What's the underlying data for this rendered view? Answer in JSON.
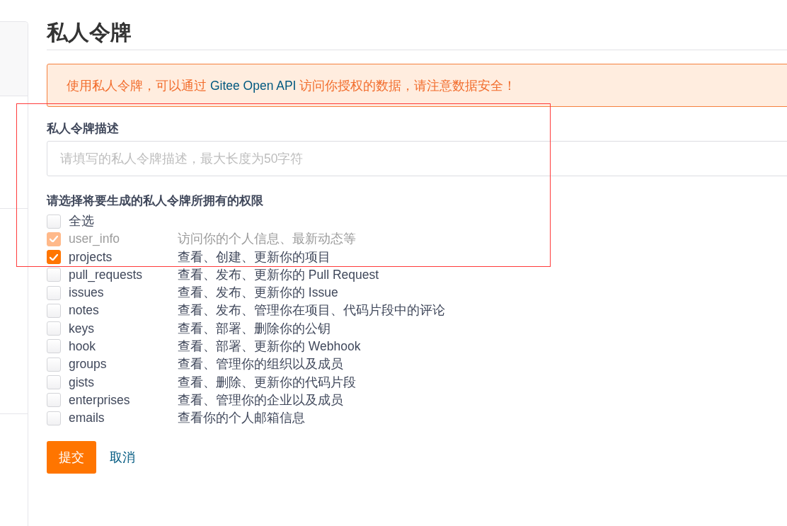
{
  "page_title": "私人令牌",
  "notice": {
    "before": "使用私人令牌，可以通过 ",
    "link": "Gitee Open API",
    "after": " 访问你授权的数据，请注意数据安全！"
  },
  "description_field": {
    "label": "私人令牌描述",
    "placeholder": "请填写的私人令牌描述，最大长度为50字符"
  },
  "permissions": {
    "label": "请选择将要生成的私人令牌所拥有的权限",
    "items": [
      {
        "name": "全选",
        "checked": false,
        "disabled": false
      },
      {
        "name": "user_info",
        "description": "访问你的个人信息、最新动态等",
        "checked": true,
        "disabled": true
      },
      {
        "name": "projects",
        "description": "查看、创建、更新你的项目",
        "checked": true,
        "disabled": false
      },
      {
        "name": "pull_requests",
        "description": "查看、发布、更新你的 Pull Request",
        "checked": false,
        "disabled": false
      },
      {
        "name": "issues",
        "description": "查看、发布、更新你的 Issue",
        "checked": false,
        "disabled": false
      },
      {
        "name": "notes",
        "description": "查看、发布、管理你在项目、代码片段中的评论",
        "checked": false,
        "disabled": false
      },
      {
        "name": "keys",
        "description": "查看、部署、删除你的公钥",
        "checked": false,
        "disabled": false
      },
      {
        "name": "hook",
        "description": "查看、部署、更新你的 Webhook",
        "checked": false,
        "disabled": false
      },
      {
        "name": "groups",
        "description": "查看、管理你的组织以及成员",
        "checked": false,
        "disabled": false
      },
      {
        "name": "gists",
        "description": "查看、删除、更新你的代码片段",
        "checked": false,
        "disabled": false
      },
      {
        "name": "enterprises",
        "description": "查看、管理你的企业以及成员",
        "checked": false,
        "disabled": false
      },
      {
        "name": "emails",
        "description": "查看你的个人邮箱信息",
        "checked": false,
        "disabled": false
      }
    ]
  },
  "actions": {
    "submit": "提交",
    "cancel": "取消"
  },
  "highlight": {
    "kind": "rectangle"
  }
}
